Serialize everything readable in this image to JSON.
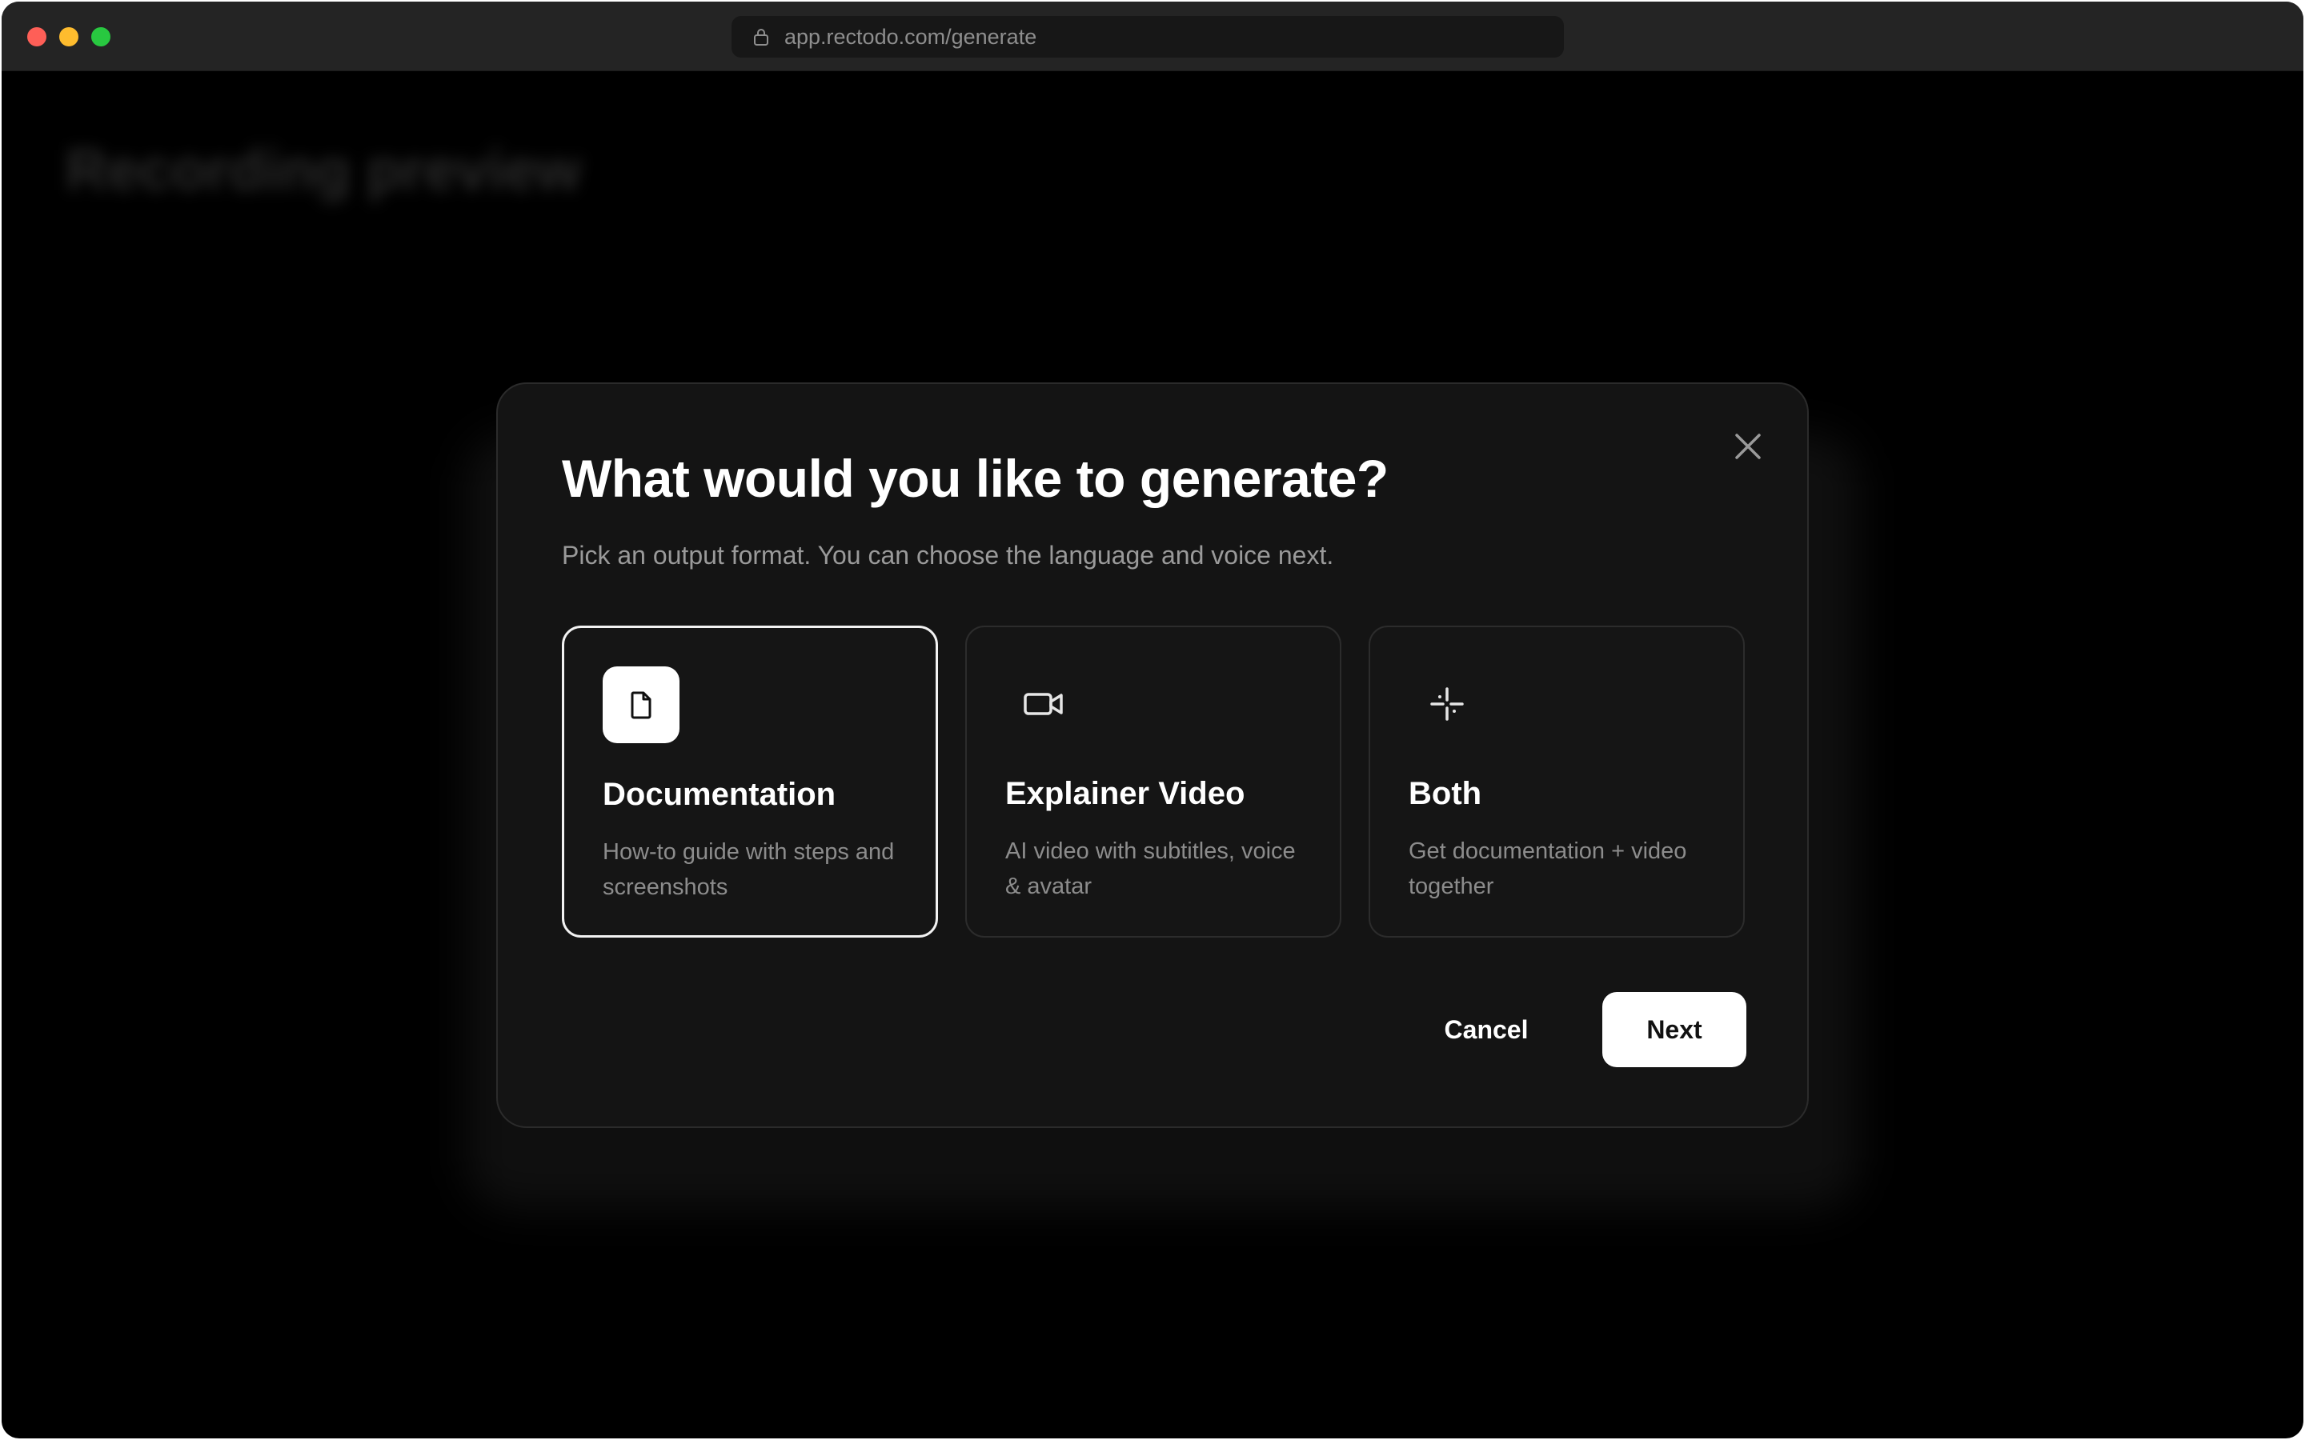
{
  "browser": {
    "url": "app.rectodo.com/generate",
    "icons": {
      "lock": "lock-icon"
    }
  },
  "background": {
    "page_title": "Recording preview"
  },
  "modal": {
    "title": "What would you like to generate?",
    "subtitle": "Pick an output format. You can choose the language and voice next.",
    "options": [
      {
        "title": "Documentation",
        "description": "How-to guide with steps and screenshots",
        "icon": "document-icon",
        "selected": true
      },
      {
        "title": "Explainer Video",
        "description": "AI video with subtitles, voice & avatar",
        "icon": "video-camera-icon",
        "selected": false
      },
      {
        "title": "Both",
        "description": "Get documentation + video together",
        "icon": "sparkle-icon",
        "selected": false
      }
    ],
    "cancel_label": "Cancel",
    "next_label": "Next",
    "close_icon": "close-icon"
  },
  "colors": {
    "modal_bg": "#141414",
    "page_bg": "#000000",
    "titlebar_bg": "#242424",
    "selected_border": "#f2f2f2",
    "primary_button_bg": "#ffffff",
    "traffic_red": "#fe5f57",
    "traffic_yellow": "#febc2e",
    "traffic_green": "#28c840"
  }
}
